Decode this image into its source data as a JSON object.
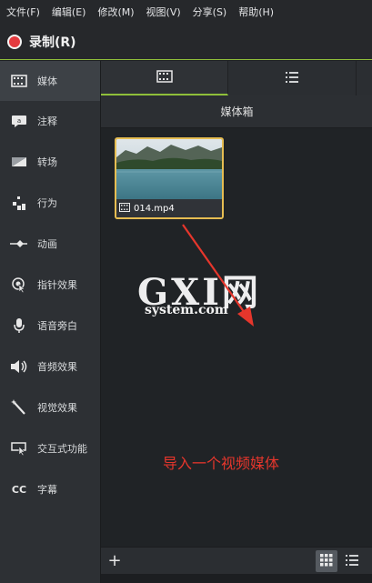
{
  "menubar": {
    "items": [
      "文件(F)",
      "编辑(E)",
      "修改(M)",
      "视图(V)",
      "分享(S)",
      "帮助(H)"
    ]
  },
  "record": {
    "label": "录制(R)",
    "color": "#e43a3f"
  },
  "sidebar": {
    "items": [
      {
        "label": "媒体",
        "icon": "film-icon",
        "active": true
      },
      {
        "label": "注释",
        "icon": "annotation-icon",
        "active": false
      },
      {
        "label": "转场",
        "icon": "transition-icon",
        "active": false
      },
      {
        "label": "行为",
        "icon": "behavior-icon",
        "active": false
      },
      {
        "label": "动画",
        "icon": "animation-icon",
        "active": false
      },
      {
        "label": "指针效果",
        "icon": "cursor-effect-icon",
        "active": false
      },
      {
        "label": "语音旁白",
        "icon": "microphone-icon",
        "active": false
      },
      {
        "label": "音频效果",
        "icon": "speaker-icon",
        "active": false
      },
      {
        "label": "视觉效果",
        "icon": "magic-wand-icon",
        "active": false
      },
      {
        "label": "交互式功能",
        "icon": "interactive-icon",
        "active": false
      },
      {
        "label": "字幕",
        "icon": "cc-icon",
        "active": false
      }
    ]
  },
  "main": {
    "tabs": [
      {
        "icon": "film-icon",
        "active": true
      },
      {
        "icon": "list-icon",
        "active": false
      }
    ],
    "section_title": "媒体箱",
    "media": [
      {
        "filename": "014.mp4",
        "selected": true
      }
    ]
  },
  "overlay": {
    "watermark_main": "GXI网",
    "watermark_sub": "system.com",
    "annotation": "导入一个视频媒体",
    "annotation_color": "#e6362c"
  },
  "bottom": {
    "add_label": "+"
  },
  "colors": {
    "accent": "#8fbf3a",
    "selection": "#e6bd52"
  }
}
